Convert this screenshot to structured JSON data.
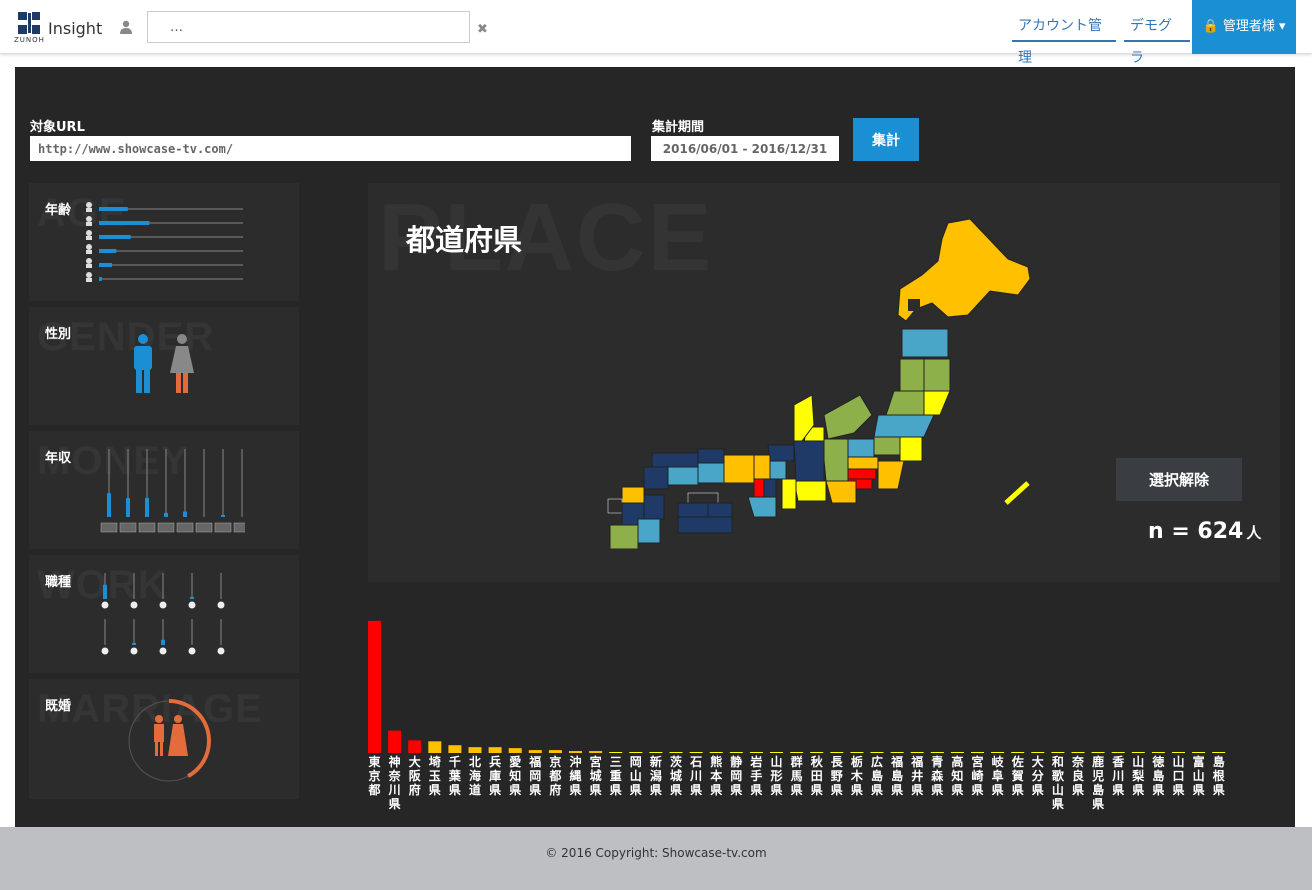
{
  "header": {
    "brand": "Insight",
    "logo_text": "ZUNOH",
    "search_value": "…",
    "nav": {
      "account": "アカウント管理",
      "demographics": "デモグラ",
      "admin": "管理者様"
    }
  },
  "form": {
    "url_label": "対象URL",
    "url_value": "http://www.showcase-tv.com/",
    "period_label": "集計期間",
    "period_value": "2016/06/01 - 2016/12/31",
    "submit_label": "集計"
  },
  "cards": {
    "age": {
      "title": "年齢",
      "bg": "AGE",
      "bars": [
        0.2,
        0.35,
        0.22,
        0.12,
        0.09,
        0.02
      ]
    },
    "gender": {
      "title": "性別",
      "bg": "GENDER"
    },
    "money": {
      "title": "年収",
      "bg": "MONEY",
      "bars": [
        0.35,
        0.28,
        0.28,
        0.06,
        0.08,
        0.0,
        0.03,
        0.0
      ]
    },
    "work": {
      "title": "職種",
      "bg": "WORK",
      "row1": [
        0.55,
        0.0,
        0.0,
        0.08,
        0.0,
        0.02
      ],
      "row2": [
        0.0,
        0.08,
        0.2,
        0.0,
        0.0,
        0.0
      ]
    },
    "marriage": {
      "title": "既婚",
      "bg": "MARRIAGE",
      "ratio": 0.42
    }
  },
  "place": {
    "bg": "PLACE",
    "title": "都道府県",
    "clear_label": "選択解除",
    "count_prefix": "n = 624",
    "count_unit": "人"
  },
  "chart_data": {
    "type": "bar",
    "categories": [
      "東京都",
      "神奈川県",
      "大阪府",
      "埼玉県",
      "千葉県",
      "北海道",
      "兵庫県",
      "愛知県",
      "福岡県",
      "京都府",
      "沖縄県",
      "宮城県",
      "三重県",
      "岡山県",
      "新潟県",
      "茨城県",
      "石川県",
      "熊本県",
      "静岡県",
      "岩手県",
      "山形県",
      "群馬県",
      "秋田県",
      "長野県",
      "栃木県",
      "広島県",
      "福島県",
      "福井県",
      "青森県",
      "高知県",
      "宮崎県",
      "岐阜県",
      "佐賀県",
      "大分県",
      "和歌山県",
      "奈良県",
      "鹿児島県",
      "香川県",
      "山梨県",
      "徳島県",
      "山口県",
      "富山県",
      "島根県"
    ],
    "values": [
      136,
      23,
      13,
      12,
      8,
      6,
      6,
      5,
      3,
      3,
      2,
      2,
      1,
      1,
      1,
      1,
      1,
      1,
      1,
      1,
      1,
      1,
      1,
      0,
      0,
      0,
      0,
      0,
      0,
      0,
      0,
      0,
      0,
      0,
      0,
      0,
      0,
      0,
      0,
      0,
      0,
      0,
      0
    ],
    "ylim": [
      0,
      140
    ],
    "colors": {
      "high": "#ff0000",
      "mid": "#ff6600",
      "low": "#ffc000",
      "min": "#ffff00"
    }
  },
  "footer": {
    "copyright": "© 2016 Copyright: Showcase-tv.com"
  }
}
